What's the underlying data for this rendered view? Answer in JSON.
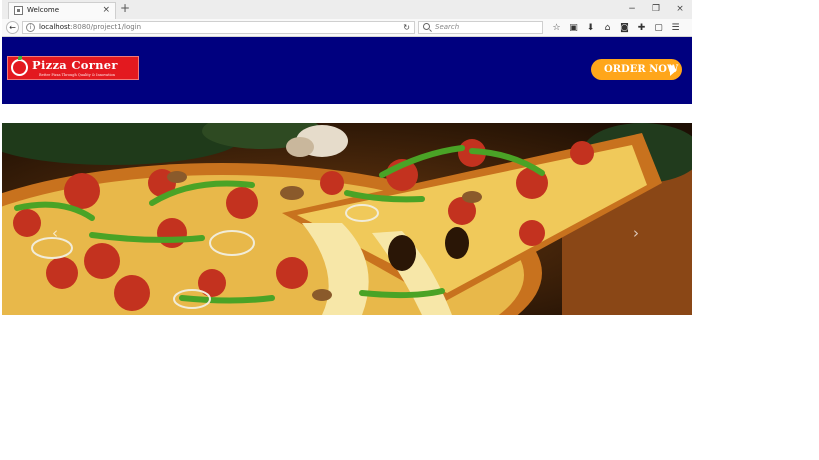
{
  "browser": {
    "tab": {
      "title": "Welcome",
      "close_glyph": "×"
    },
    "new_tab_glyph": "+",
    "window_controls": [
      "−",
      "❐",
      "×"
    ],
    "url": {
      "host": "localhost",
      "path": ":8080/project1/login"
    },
    "search_placeholder": "Search",
    "toolbar_icons": [
      "star-icon",
      "reading-list-icon",
      "download-icon",
      "home-icon",
      "pocket-icon",
      "extension-icon",
      "screenshot-icon",
      "menu-icon"
    ]
  },
  "site": {
    "logo": {
      "name": "Pizza Corner",
      "tagline": "Better Pizza Through Quality & Innovation"
    },
    "order_button": "ORDER NOW",
    "colors": {
      "header_bg": "#00007f",
      "logo_red": "#e3191f",
      "order_orange": "#ffa61a"
    }
  },
  "carousel": {
    "prev_glyph": "‹",
    "next_glyph": "›"
  }
}
